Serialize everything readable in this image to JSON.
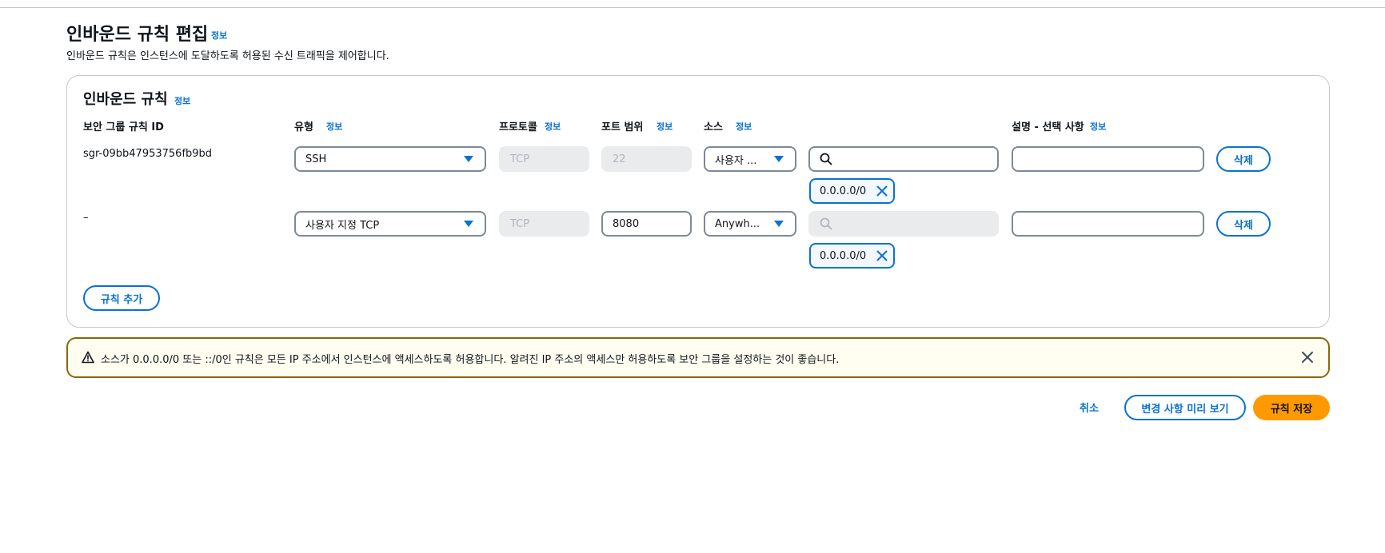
{
  "header": {
    "title": "인바운드 규칙 편집",
    "info": "정보",
    "description": "인바운드 규칙은 인스턴스에 도달하도록 허용된 수신 트래픽을 제어합니다."
  },
  "panel": {
    "title": "인바운드 규칙",
    "info": "정보",
    "columns": {
      "rule_id": "보안 그룹 규칙 ID",
      "type": "유형",
      "protocol": "프로토콜",
      "port_range": "포트 범위",
      "source": "소스",
      "description": "설명 - 선택 사항",
      "info": "정보"
    },
    "rules": [
      {
        "id": "sgr-09bb47953756fb9bd",
        "type": "SSH",
        "protocol": "TCP",
        "port": "22",
        "source": "사용자 ...",
        "token": "0.0.0.0/0",
        "delete_label": "삭제"
      },
      {
        "id": "–",
        "type": "사용자 지정 TCP",
        "protocol": "TCP",
        "port": "8080",
        "source": "Anywh...",
        "token": "0.0.0.0/0",
        "delete_label": "삭제"
      }
    ],
    "add_rule_label": "규칙 추가"
  },
  "alert": {
    "message": "소스가 0.0.0.0/0 또는 ::/0인 규칙은 모든 IP 주소에서 인스턴스에 액세스하도록 허용합니다. 알려진 IP 주소의 액세스만 허용하도록 보안 그룹을 설정하는 것이 좋습니다."
  },
  "footer": {
    "cancel_label": "취소",
    "preview_label": "변경 사항 미리 보기",
    "save_label": "규칙 저장"
  },
  "colors": {
    "accent": "#0972d3",
    "primary_button": "#ff9900",
    "warning_border": "#8d6605",
    "warning_bg": "#fffef0"
  },
  "icons": {
    "search": "search-icon",
    "remove": "close-icon",
    "warning": "warning-icon",
    "dismiss": "close-icon",
    "dropdown": "caret-down-icon"
  }
}
